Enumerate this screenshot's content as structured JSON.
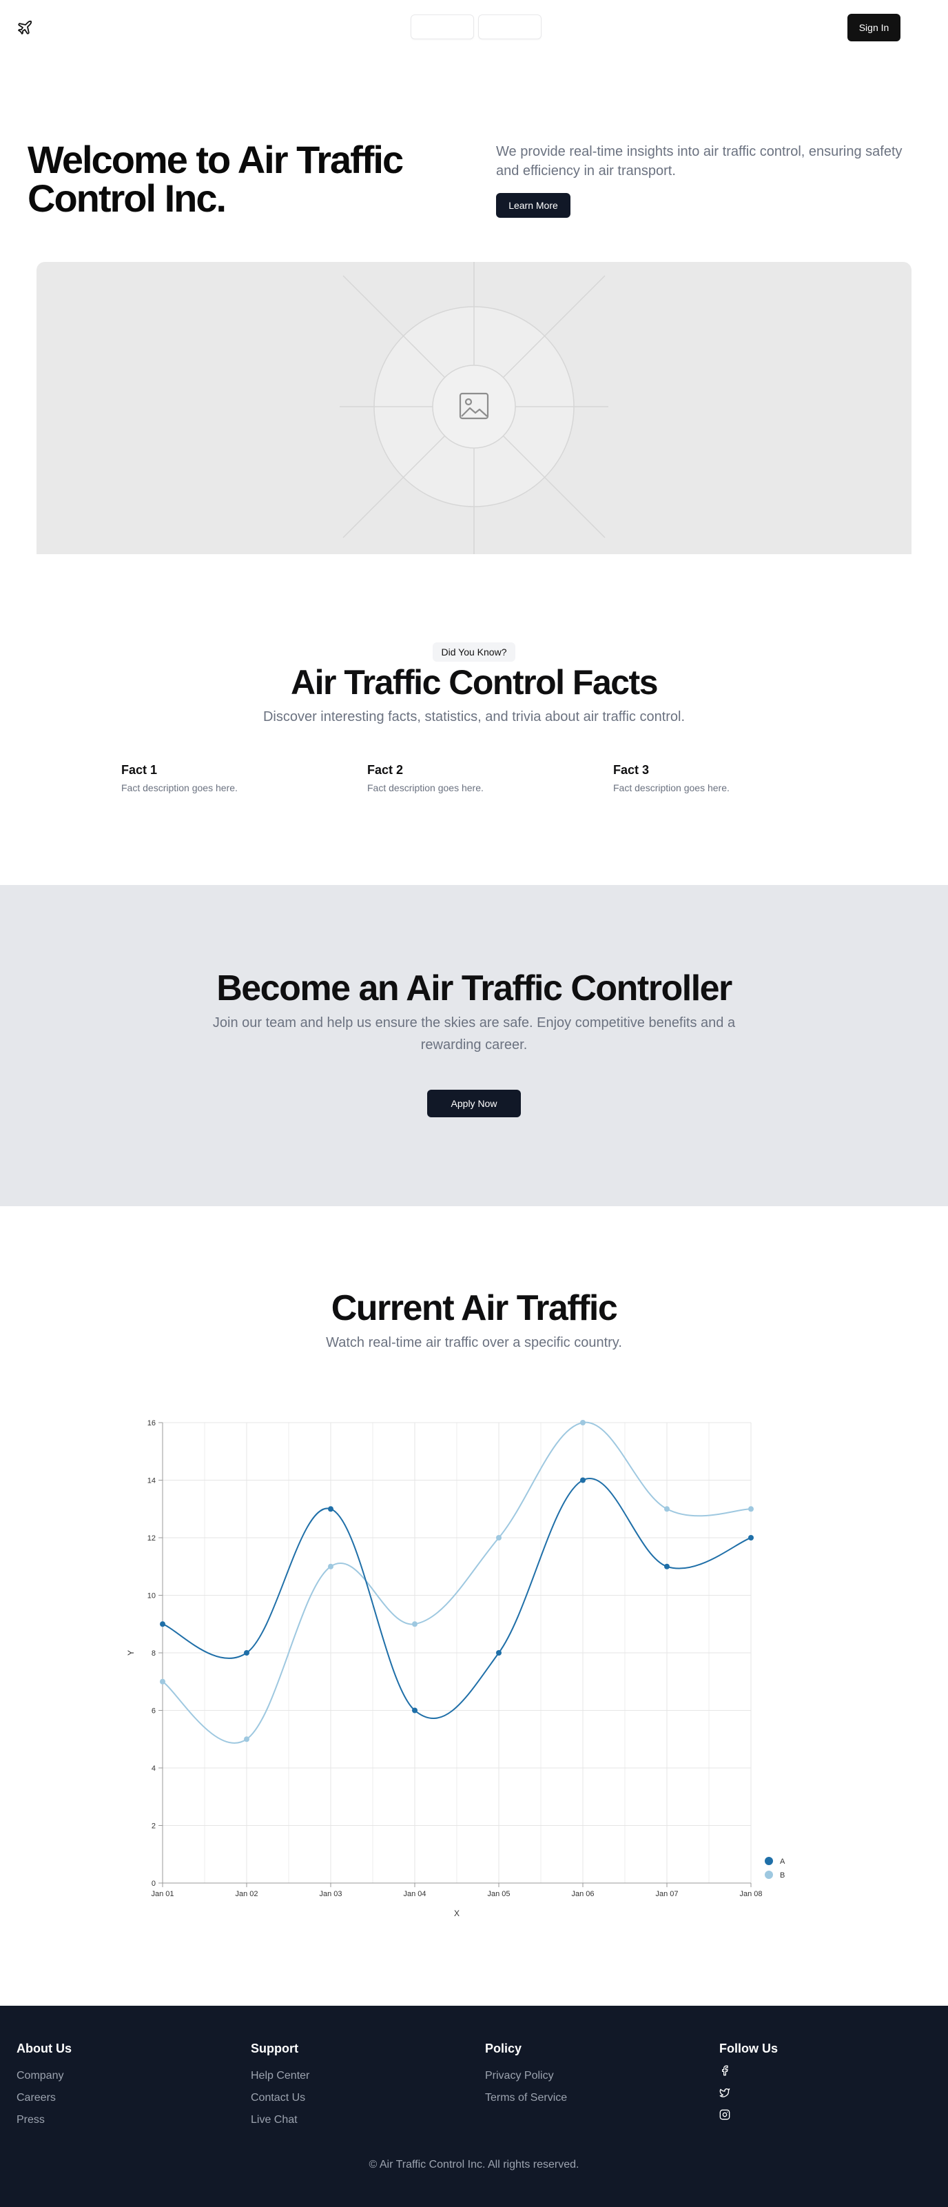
{
  "nav": {
    "logo_icon": "plane-icon",
    "sign_in": "Sign In"
  },
  "hero": {
    "title": "Welcome to Air Traffic Control Inc.",
    "description": "We provide real-time insights into air traffic control, ensuring safety and efficiency in air transport.",
    "cta": "Learn More",
    "image_icon": "image-placeholder-icon"
  },
  "facts": {
    "badge": "Did You Know?",
    "title": "Air Traffic Control Facts",
    "subtitle": "Discover interesting facts, statistics, and trivia about air traffic control.",
    "items": [
      {
        "title": "Fact 1",
        "description": "Fact description goes here."
      },
      {
        "title": "Fact 2",
        "description": "Fact description goes here."
      },
      {
        "title": "Fact 3",
        "description": "Fact description goes here."
      }
    ]
  },
  "join": {
    "title": "Become an Air Traffic Controller",
    "description": "Join our team and help us ensure the skies are safe. Enjoy competitive benefits and a rewarding career.",
    "cta": "Apply Now"
  },
  "traffic": {
    "title": "Current Air Traffic",
    "subtitle": "Watch real-time air traffic over a specific country."
  },
  "chart_data": {
    "type": "line",
    "x": [
      "Jan 01",
      "Jan 02",
      "Jan 03",
      "Jan 04",
      "Jan 05",
      "Jan 06",
      "Jan 07",
      "Jan 08"
    ],
    "series": [
      {
        "name": "A",
        "color": "#1f6fa8",
        "values": [
          9,
          8,
          13,
          6,
          8,
          14,
          11,
          12
        ]
      },
      {
        "name": "B",
        "color": "#9ec8e0",
        "values": [
          7,
          5,
          11,
          9,
          12,
          16,
          13,
          13
        ]
      }
    ],
    "xlabel": "X",
    "ylabel": "Y",
    "ylim": [
      0,
      16
    ],
    "yticks": [
      "0",
      "2",
      "4",
      "6",
      "8",
      "10",
      "12",
      "14",
      "16"
    ],
    "grid": true,
    "legend": "bottom-right"
  },
  "footer": {
    "columns": [
      {
        "title": "About Us",
        "links": [
          "Company",
          "Careers",
          "Press"
        ]
      },
      {
        "title": "Support",
        "links": [
          "Help Center",
          "Contact Us",
          "Live Chat"
        ]
      },
      {
        "title": "Policy",
        "links": [
          "Privacy Policy",
          "Terms of Service"
        ]
      },
      {
        "title": "Follow Us",
        "icons": [
          "facebook-icon",
          "twitter-icon",
          "instagram-icon"
        ]
      }
    ],
    "copyright": "© Air Traffic Control Inc. All rights reserved."
  }
}
